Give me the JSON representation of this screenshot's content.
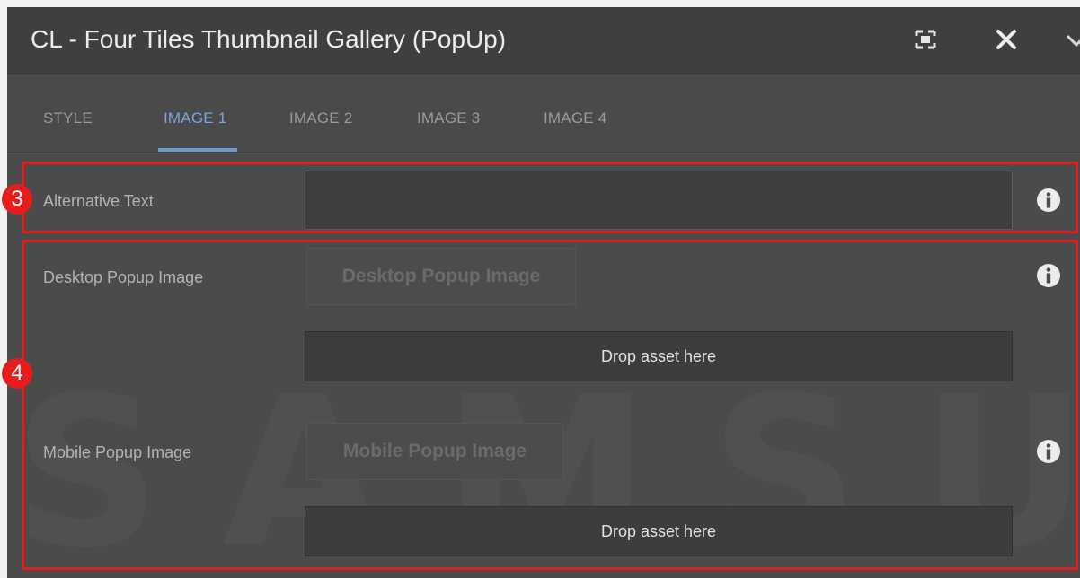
{
  "dialog": {
    "title": "CL - Four Tiles Thumbnail Gallery (PopUp)",
    "buttons": {
      "fullscreen_icon": "fullscreen-icon",
      "close_icon": "close-icon",
      "collapse_icon": "chevron-down-icon"
    }
  },
  "tabs": [
    {
      "label": "STYLE",
      "active": false
    },
    {
      "label": "IMAGE 1",
      "active": true
    },
    {
      "label": "IMAGE 2",
      "active": false
    },
    {
      "label": "IMAGE 3",
      "active": false
    },
    {
      "label": "IMAGE 4",
      "active": false
    }
  ],
  "fields": {
    "alt_text": {
      "label": "Alternative Text",
      "value": ""
    },
    "desktop_popup": {
      "label": "Desktop Popup Image",
      "button": "Desktop Popup Image",
      "drop": "Drop asset here"
    },
    "mobile_popup": {
      "label": "Mobile Popup Image",
      "button": "Mobile Popup Image",
      "drop": "Drop asset here"
    }
  },
  "annotations": {
    "badge_3": "3",
    "badge_4": "4",
    "highlight_color": "#e0201f"
  },
  "watermark": "SAMSUNG",
  "colors": {
    "dialog_bg": "#4b4b4b",
    "titlebar_bg": "#3f3f3f",
    "active_tab": "#7ba4dc",
    "badge": "#e51d1d"
  }
}
